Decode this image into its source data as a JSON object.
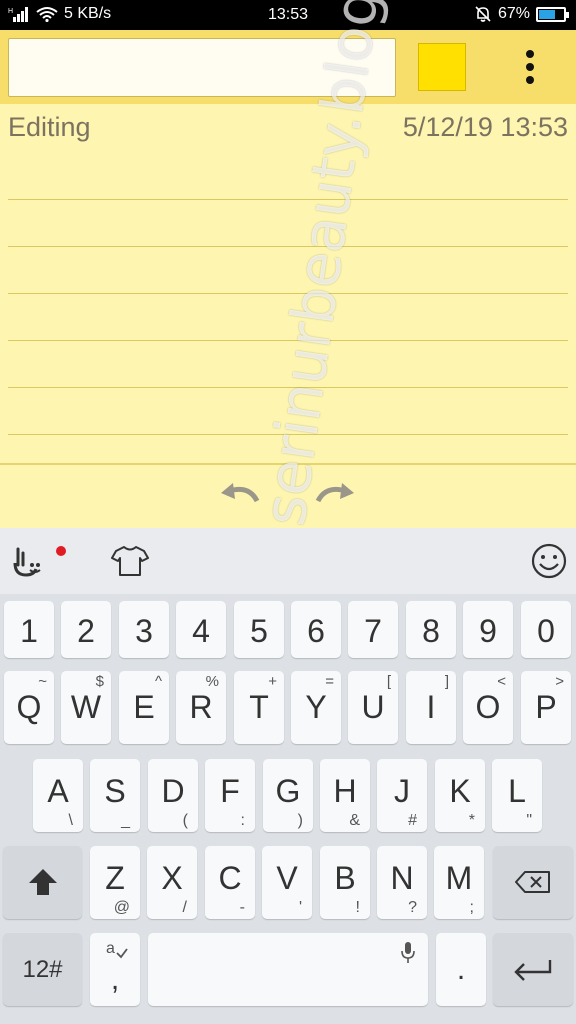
{
  "status_bar": {
    "network_speed": "5 KB/s",
    "time": "13:53",
    "battery_percent": "67%",
    "battery_level": 0.67,
    "icons": [
      "signal-icon",
      "wifi-icon",
      "silent-bell-icon",
      "battery-icon"
    ]
  },
  "toolbar": {
    "title_value": "",
    "title_placeholder": "",
    "note_color": "#ffe000"
  },
  "note": {
    "status": "Editing",
    "timestamp": "5/12/19 13:53",
    "line_color": "#dbc960",
    "background": "#fdf5b0"
  },
  "edit_actions": {
    "icons": [
      "undo-icon",
      "redo-icon"
    ]
  },
  "keyboard_bar": {
    "icons": [
      "keyboard-logo-icon",
      "theme-shirt-icon",
      "emoji-icon"
    ]
  },
  "keyboard": {
    "row1": [
      {
        "main": "1"
      },
      {
        "main": "2"
      },
      {
        "main": "3"
      },
      {
        "main": "4"
      },
      {
        "main": "5"
      },
      {
        "main": "6"
      },
      {
        "main": "7"
      },
      {
        "main": "8"
      },
      {
        "main": "9"
      },
      {
        "main": "0"
      }
    ],
    "row2": [
      {
        "main": "Q",
        "sup": "~"
      },
      {
        "main": "W",
        "sup": "$"
      },
      {
        "main": "E",
        "sup": "^"
      },
      {
        "main": "R",
        "sup": "%"
      },
      {
        "main": "T",
        "sup": "+"
      },
      {
        "main": "Y",
        "sup": "="
      },
      {
        "main": "U",
        "sup": "["
      },
      {
        "main": "I",
        "sup": "]"
      },
      {
        "main": "O",
        "sup": "<"
      },
      {
        "main": "P",
        "sup": ">"
      }
    ],
    "row3": [
      {
        "main": "A",
        "sub": "\\"
      },
      {
        "main": "S",
        "sub": "_"
      },
      {
        "main": "D",
        "sub": "("
      },
      {
        "main": "F",
        "sub": ":"
      },
      {
        "main": "G",
        "sub": ")"
      },
      {
        "main": "H",
        "sub": "&"
      },
      {
        "main": "J",
        "sub": "#"
      },
      {
        "main": "K",
        "sub": "*"
      },
      {
        "main": "L",
        "sub": "\""
      }
    ],
    "row4": [
      {
        "main": "Z",
        "sub": "@"
      },
      {
        "main": "X",
        "sub": "/"
      },
      {
        "main": "C",
        "sub": "-"
      },
      {
        "main": "V",
        "sub": "'"
      },
      {
        "main": "B",
        "sub": "!"
      },
      {
        "main": "N",
        "sub": "?"
      },
      {
        "main": "M",
        "sub": ";"
      }
    ],
    "symbols_key": "12#",
    "comma_key": ",",
    "period_key": ".",
    "special_icons": [
      "shift-icon",
      "backspace-icon",
      "autocorrect-icon",
      "microphone-icon",
      "enter-icon"
    ]
  },
  "watermark": "serinurbeauty.blogspot.com"
}
